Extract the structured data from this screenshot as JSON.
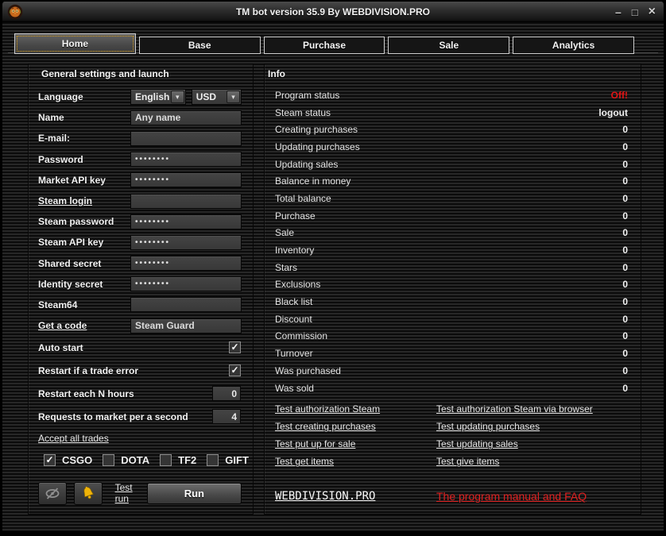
{
  "window": {
    "title": "TM bot version 35.9 By WEBDIVISION.PRO",
    "controls": {
      "minimize": "–",
      "maximize": "□",
      "close": "×"
    }
  },
  "icons": {
    "combo_arrow": "▾",
    "check": "✓"
  },
  "colors": {
    "status_off_red": "#e01515",
    "manual_red": "#e02020",
    "bell_gold": "#f0b409"
  },
  "tabs": [
    {
      "label": "Home",
      "active": true
    },
    {
      "label": "Base",
      "active": false
    },
    {
      "label": "Purchase",
      "active": false
    },
    {
      "label": "Sale",
      "active": false
    },
    {
      "label": "Analytics",
      "active": false
    }
  ],
  "general": {
    "title": "General settings and launch",
    "fields": [
      {
        "label": "Language",
        "type": "combo-pair",
        "options": [
          "English",
          "USD"
        ]
      },
      {
        "label": "Name",
        "type": "text",
        "value": "Any name"
      },
      {
        "label": "E-mail:",
        "type": "text",
        "value": ""
      },
      {
        "label": "Password",
        "type": "password",
        "value": "••••••••"
      },
      {
        "label": "Market API key",
        "type": "password",
        "value": "••••••••"
      },
      {
        "label": "Steam login",
        "type": "text",
        "value": "",
        "link": true
      },
      {
        "label": "Steam password",
        "type": "password",
        "value": "••••••••"
      },
      {
        "label": "Steam API key",
        "type": "password",
        "value": "••••••••"
      },
      {
        "label": "Shared secret",
        "type": "password",
        "value": "••••••••"
      },
      {
        "label": "Identity secret",
        "type": "password",
        "value": "••••••••"
      },
      {
        "label": "Steam64",
        "type": "text",
        "value": ""
      },
      {
        "label": "Get a code",
        "type": "text",
        "value": "Steam Guard",
        "link": true
      }
    ],
    "toggles": [
      {
        "label": "Auto start",
        "checked": true
      },
      {
        "label": "Restart if a trade error",
        "checked": true
      }
    ],
    "numerics": [
      {
        "label": "Restart each N hours",
        "value": "0"
      },
      {
        "label": "Requests to market per a second",
        "value": "4"
      }
    ],
    "accept_link": "Accept all trades",
    "games": [
      {
        "label": "CSGO",
        "checked": true
      },
      {
        "label": "DOTA",
        "checked": false
      },
      {
        "label": "TF2",
        "checked": false
      },
      {
        "label": "GIFT",
        "checked": false
      }
    ],
    "actions": {
      "test_run": "Test run",
      "run": "Run"
    }
  },
  "info": {
    "title": "Info",
    "rows": [
      {
        "label": "Program status",
        "value": "Off!",
        "color": "#e01515"
      },
      {
        "label": "Steam status",
        "value": "logout"
      },
      {
        "label": "Creating purchases",
        "value": "0"
      },
      {
        "label": "Updating purchases",
        "value": "0"
      },
      {
        "label": "Updating sales",
        "value": "0"
      },
      {
        "label": "Balance in money",
        "value": "0"
      },
      {
        "label": "Total balance",
        "value": "0"
      },
      {
        "label": "Purchase",
        "value": "0"
      },
      {
        "label": "Sale",
        "value": "0"
      },
      {
        "label": "Inventory",
        "value": "0"
      },
      {
        "label": "Stars",
        "value": "0"
      },
      {
        "label": "Exclusions",
        "value": "0"
      },
      {
        "label": "Black list",
        "value": "0"
      },
      {
        "label": "Discount",
        "value": "0"
      },
      {
        "label": "Commission",
        "value": "0"
      },
      {
        "label": "Turnover",
        "value": "0"
      },
      {
        "label": "Was purchased",
        "value": "0"
      },
      {
        "label": "Was sold",
        "value": "0"
      }
    ],
    "test_links": {
      "col1": [
        "Test authorization Steam",
        "Test creating purchases",
        "Test put up for sale",
        "Test get items"
      ],
      "col2": [
        "Test authorization Steam via browser",
        "Test updating purchases",
        "Test updating sales",
        "Test give items"
      ]
    },
    "footer": {
      "site": "WEBDIVISION.PRO",
      "manual": "The program manual and FAQ"
    }
  }
}
